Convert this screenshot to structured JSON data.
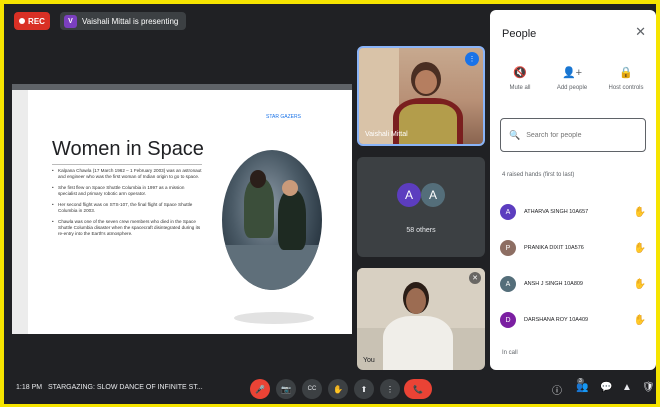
{
  "recording": {
    "label": "REC"
  },
  "presenter": {
    "initial": "V",
    "text": "Vaishali Mittal is presenting"
  },
  "slide": {
    "link": "STAR GAZERS",
    "title": "Women in Space",
    "bullets": [
      "Kalpana Chawla (17 March 1962 – 1 February 2003) was an astronaut and engineer who was the first woman of Indian origin to go to space.",
      "She first flew on Space Shuttle Columbia in 1997 as a mission specialist and primary robotic arm operator.",
      "Her second flight was on STS-107, the final flight of Space Shuttle Columbia in 2003.",
      "Chawla was one of the seven crew members who died in the Space Shuttle Columbia disaster when the spacecraft disintegrated during its re-entry into the Earth's atmosphere."
    ]
  },
  "tiles": {
    "speaker_name": "Vaishali Mittal",
    "others_initials": [
      "A",
      "A"
    ],
    "others_label": "58 others",
    "cam_name": "You"
  },
  "people": {
    "title": "People",
    "close": "✕",
    "actions": [
      {
        "icon": "🔇",
        "label": "Mute all"
      },
      {
        "icon": "👤+",
        "label": "Add people"
      },
      {
        "icon": "🔒",
        "label": "Host controls"
      }
    ],
    "search_placeholder": "Search for people",
    "raised_label": "4 raised hands (first to last)",
    "raised": [
      {
        "initial": "A",
        "name": "ATHARVA SINGH 10A657",
        "color": "#5c3dbf"
      },
      {
        "initial": "P",
        "name": "PRANIKA DIXIT 10A576",
        "color": "#8d6e63"
      },
      {
        "initial": "A",
        "name": "ANSH J SINGH 10A809",
        "color": "#546e7a"
      },
      {
        "initial": "D",
        "name": "DARSHANA ROY 10A409",
        "color": "#7b1fa2"
      }
    ],
    "in_call_label": "In call"
  },
  "bottom": {
    "time": "1:18 PM",
    "meeting_title": "STARGAZING: SLOW DANCE OF INFINITE ST...",
    "controls": [
      "🎤",
      "📷",
      "CC",
      "✋",
      "⬆",
      "⋮",
      "📞"
    ],
    "side_icons": [
      "ⓘ",
      "👥",
      "💬",
      "▲",
      "🛡"
    ],
    "participants_badge": "3"
  }
}
